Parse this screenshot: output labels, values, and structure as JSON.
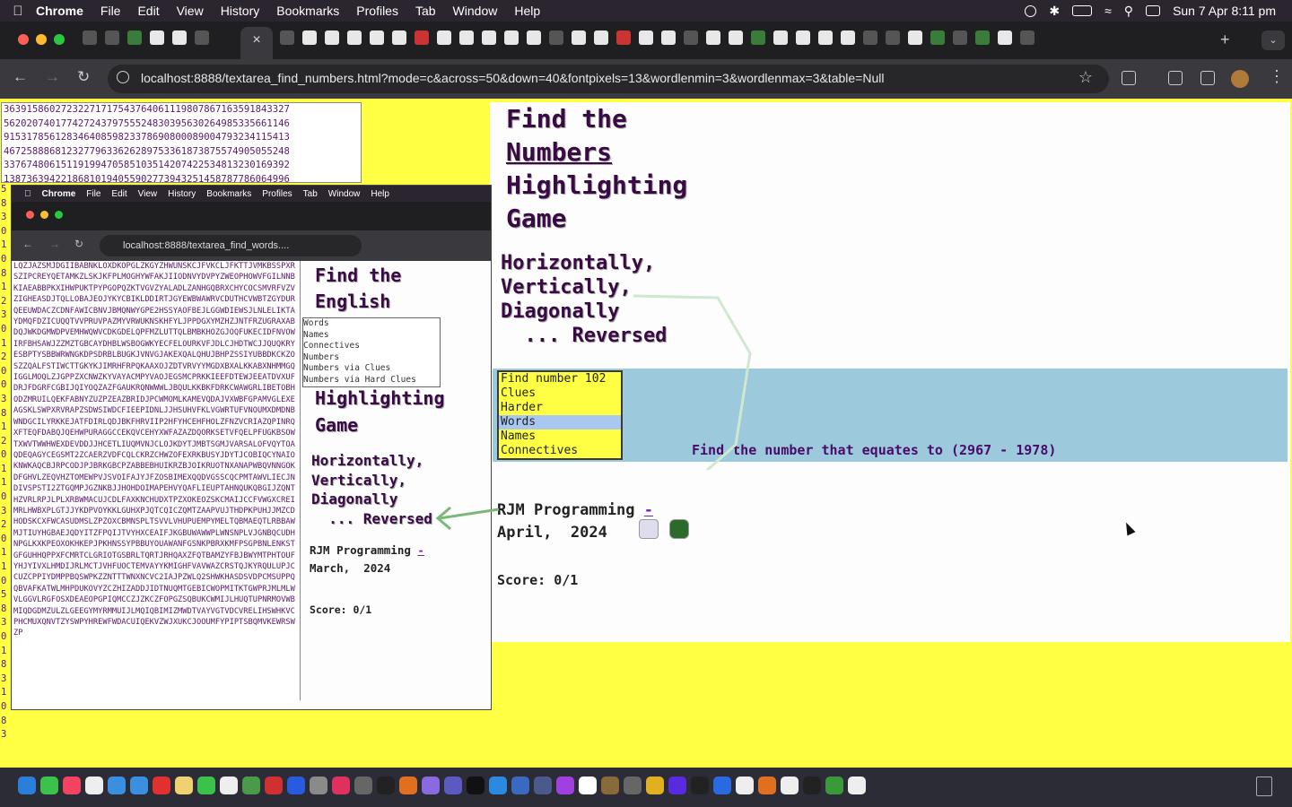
{
  "menubar": {
    "app": "Chrome",
    "items": [
      "File",
      "Edit",
      "View",
      "History",
      "Bookmarks",
      "Profiles",
      "Tab",
      "Window",
      "Help"
    ],
    "clock": "Sun 7 Apr  8:11 pm"
  },
  "toolbar": {
    "url": "localhost:8888/textarea_find_numbers.html?mode=c&across=50&down=40&fontpixels=13&wordlenmin=3&wordlenmax=3&table=Null"
  },
  "numbers_grid": [
    "36391586027232271717543764061119807867163591843327",
    "56202074017742724379755524830395630264985335661146",
    "91531785612834640859823378690800089004793234115413",
    "46725888681232779633626289753361873875574905055248",
    "33767480615119199470585103514207422534813230169392",
    "13873639422186810194055902773943251458787786064996"
  ],
  "left_digits": "5830108123012003812011032011058301831083010",
  "game": {
    "title_line1": "Find the",
    "title_line2": "Numbers",
    "title_line3": "Highlighting",
    "title_line4": "Game",
    "subtitle": "Horizontally,\nVertically,\nDiagonally\n  ... Reversed",
    "select_options": [
      "Find number 102",
      "Clues",
      "Harder",
      "Words",
      "Names",
      "Connectives"
    ],
    "selected_index": 3,
    "question": "Find the number that equates to (2967 - 1978)",
    "credit_line1": "RJM Programming ",
    "credit_link": "-",
    "credit_line2": "April,  2024",
    "score": "Score: 0/1"
  },
  "inset": {
    "menubar": [
      "Chrome",
      "File",
      "Edit",
      "View",
      "History",
      "Bookmarks",
      "Profiles",
      "Tab",
      "Window",
      "Help"
    ],
    "url": "localhost:8888/textarea_find_words....",
    "letters": "LQZJAZSMJDGIIBABNKLOXDKOPGLZKGYZHWUNSKCJFVKCLJFKTTJVMKBSSPXRSZIPCREYQETAMKZLSKJKFPLMOGHYWFAKJIIODNVYDVPYZWEOPHOWVFGILNNBKIAEABBPKXIHWPUKTPYPGOPQZKTVGVZYALADLZANHGQBRXCHYCOCSMVRFVZVZIGHEASDJTQLLOBAJEOJYKYCBIKLDDIRTJGYEWBWAWRVCDUTHCVWBTZGYDURQEEUWDACZCDNFAWICBNVJBMQNWYGPE2HSSYAOFBEJLGGWDIEWSJLNLELIKTAYDMQFDZICUQQTVVPRUVPAZMYVRWUKNSKHFYLJPPDGXYMZHZJNTFRZUGRAXABDQJWKDGMWDPVEMHWQWVCDKGDELQPFMZLUTTQLBMBKHOZGJOQFUKECIDFNVOWIRFBHSAWJZZMZTGBCAYDHBLWSBOGWKYECFELOURKVFJDLCJHDTWCJJQUQKRYESBPTYSBBWRWNGKDPSDRBLBUGKJVNVGJAKEXQALQHUJBHPZSSIYUBBDKCKZOSZZQALFSTIWCTTGKYKJIMRHFRPQKAAXOJZDTVRVYYMGDXBXALKKABXNHMMGQIGGLMOQLZJGPPZXCNWZKYVAYACMPYVAOJEGSMCPRKKIEEFDTEWJEEATDVXUFDRJFDGRFCGBIJQIYOQZAZFGAUKRQNWWWLJBQULKKBKFDRKCWAWGRLIBETOBHODZMRUILQEKFABNYZUZPZEAZBRIDJPCWMOMLKAMEVQDAJVXWBFGPAMVGLEXEAGSKLSWPXRVRAPZSDWSIWDCFIEEPIDNLJJHSUHVFKLVGWRTUFVNOUMXDMDNBWNDGCILYRKKEJATFDIRLQDJBKFHRVIIP2HFYHCEHFHOLZFNZVCRIAZQPINRQXFTEQFDABQJQEHWPURAGGCCEKQVCEHYXWFAZAZDQORKSETVFQELPFUGKBSOWTXWVTWWHWEXDEVDDJJHCETLIUQMVNJCLOJKDYTJMBTSGMJVARSALOFVQYTOAQDEQAGYCEGSMT2ZCAERZVDFCQLCKRZCHWZOFEXRKBUSYJDYTJCOBIQCYNAIOKNWKAQCBJRPCODJPJBRKGBCPZABBEBHUIKRZBJOIKRUOTNXANAPWBQVNNGOKDFGHVLZEQVHZTOMEWPVJSVOIFAJYJFZOSBIMEXQQDVGSSCQCPMTAWVLIECJNDIVSPSTI2ZTGQMPJGZNKBJJHOHDOIMAPEHVYQAFLIEUPTAHNQUKQBGIJZQNTHZVRLRPJLPLXRBWMACUJCDLFAXKNCHUDXTPZXOKEOZSKCMAIJCCFVWGXCREIMRLHWBXPLGTJJYKDPVOYKKLGUHXPJQTCQICZQMTZAAPVUJTHDPKPUHJJMZCDHODSKCXFWCASUDMSLZPZOXCBMNSPLTSVVLVHUPUEMPYMELTQBMAEQTLRBBAWMJTIUYHGBAEJQDYITZFPQIJTVYHXCEAIFJKGBUWAWWPLWNSNPLVJGNBQCUDHNPGLKXKPEOXOKHKEPJPKHNSSYPBBUYOUAWANFGSNKPBRXKMFPSGPBNLENKSTGFGUHHQPPXFCMRTCLGRIOTGSBRLTQRTJRHQAXZFQTBAMZYFBJBWYMTPHTOUFYHJYIVXLHMDIJRLMCTJVHFUOCTEMVAYYKMIGHFVAVWAZCRSTQJKYRQULUPJCCUZCPPIYDMPPBQSWPKZZNTTTWNXNCVC2IAJPZWLQ2SHWKHASDSVDPCMSUPPQQBVAFKATWLMHPDUKOVYZCZHIZADDJIDTNUQMTGEBICWOPMITKTGWPRJMLMLWVLGGVLRGFOSXDEAEOPGPIQMCCZJZKCZFOPGZSQBUKCWMIJLHUQTUPNRMOVWBMIQDGDMZULZLGEEGYMYRMMUIJLMQIQBIMIZMWDTVAYVGTVDCVRELIHSWHKVCPHCMUXQNVTZYSWPYHREWFWDACUIQEKVZWJXUKCJOOUMFYPIPTSBQMVKEWRSWZP",
    "title_line1": "Find the",
    "title_line2": "English",
    "list_options": [
      "Words",
      "Names",
      "Connectives",
      "Numbers",
      "Numbers via Clues",
      "Numbers via Hard Clues"
    ],
    "title_line3": "Highlighting",
    "title_line4": "Game",
    "subtitle": "Horizontally,\nVertically,\nDiagonally\n  ... Reversed",
    "credit_line1": "RJM Programming ",
    "credit_link": "-",
    "credit_line2": "March,  2024",
    "score": "Score: 0/1"
  },
  "colors": {
    "page_bg": "#ffff44",
    "panel_bg": "#fdfdfd",
    "band": "#9ccadc",
    "title_text": "#3a0a44",
    "letters_text": "#5a1a6a",
    "arrow": "#7ab87a"
  },
  "icons": {
    "apple": "apple-icon",
    "star": "bookmark-star-icon",
    "back": "back-arrow-icon",
    "reload": "reload-icon",
    "kebab": "more-vert-icon"
  }
}
